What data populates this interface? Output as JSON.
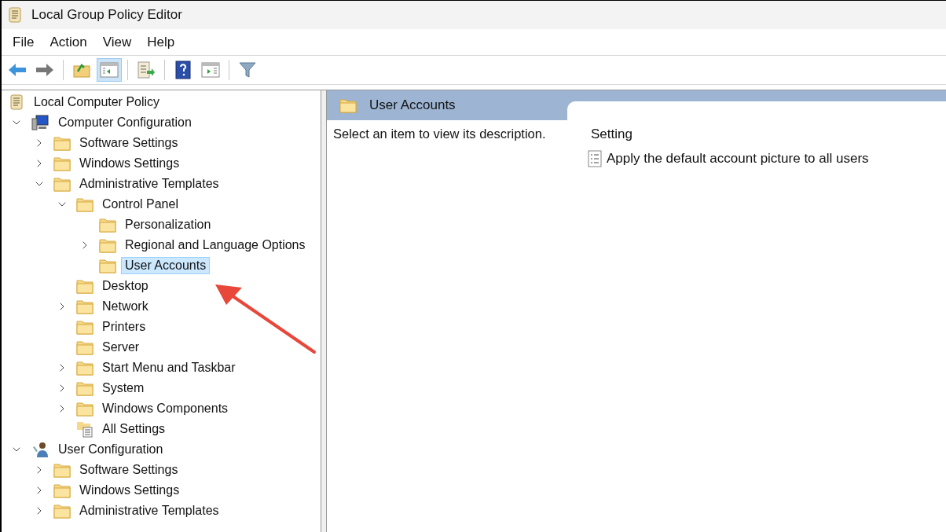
{
  "window": {
    "title": "Local Group Policy Editor"
  },
  "menu": [
    "File",
    "Action",
    "View",
    "Help"
  ],
  "toolbar": [
    {
      "kind": "back",
      "pressed": false
    },
    {
      "kind": "forward",
      "pressed": false
    },
    {
      "kind": "up",
      "pressed": false
    },
    {
      "kind": "tree",
      "pressed": true
    },
    {
      "kind": "export",
      "pressed": false
    },
    {
      "kind": "help",
      "pressed": false
    },
    {
      "kind": "pane",
      "pressed": false
    },
    {
      "kind": "filter",
      "pressed": false
    }
  ],
  "tree": [
    {
      "label": "Local Computer Policy",
      "kind": "policy",
      "selected": false,
      "children": [
        {
          "label": "Computer Configuration",
          "kind": "computer",
          "expanded": true,
          "selected": false,
          "children": [
            {
              "label": "Software Settings",
              "kind": "folder",
              "expanded": false,
              "selected": false
            },
            {
              "label": "Windows Settings",
              "kind": "folder",
              "expanded": false,
              "selected": false
            },
            {
              "label": "Administrative Templates",
              "kind": "folder",
              "expanded": true,
              "selected": false,
              "children": [
                {
                  "label": "Control Panel",
                  "kind": "folder",
                  "expanded": true,
                  "selected": false,
                  "children": [
                    {
                      "label": "Personalization",
                      "kind": "folder",
                      "selected": false
                    },
                    {
                      "label": "Regional and Language Options",
                      "kind": "folder",
                      "expanded": false,
                      "selected": false
                    },
                    {
                      "label": "User Accounts",
                      "kind": "folder",
                      "selected": true
                    }
                  ]
                },
                {
                  "label": "Desktop",
                  "kind": "folder",
                  "selected": false
                },
                {
                  "label": "Network",
                  "kind": "folder",
                  "expanded": false,
                  "selected": false
                },
                {
                  "label": "Printers",
                  "kind": "folder",
                  "selected": false
                },
                {
                  "label": "Server",
                  "kind": "folder",
                  "selected": false
                },
                {
                  "label": "Start Menu and Taskbar",
                  "kind": "folder",
                  "expanded": false,
                  "selected": false
                },
                {
                  "label": "System",
                  "kind": "folder",
                  "expanded": false,
                  "selected": false
                },
                {
                  "label": "Windows Components",
                  "kind": "folder",
                  "expanded": false,
                  "selected": false
                },
                {
                  "label": "All Settings",
                  "kind": "settings",
                  "selected": false
                }
              ]
            }
          ]
        },
        {
          "label": "User Configuration",
          "kind": "user",
          "expanded": true,
          "selected": false,
          "children": [
            {
              "label": "Software Settings",
              "kind": "folder",
              "expanded": false,
              "selected": false
            },
            {
              "label": "Windows Settings",
              "kind": "folder",
              "expanded": false,
              "selected": false
            },
            {
              "label": "Administrative Templates",
              "kind": "folder",
              "expanded": false,
              "selected": false
            }
          ]
        }
      ]
    }
  ],
  "details": {
    "title": "User Accounts",
    "description": "Select an item to view its description.",
    "column": "Setting",
    "settings": [
      "Apply the default account picture to all users"
    ]
  }
}
